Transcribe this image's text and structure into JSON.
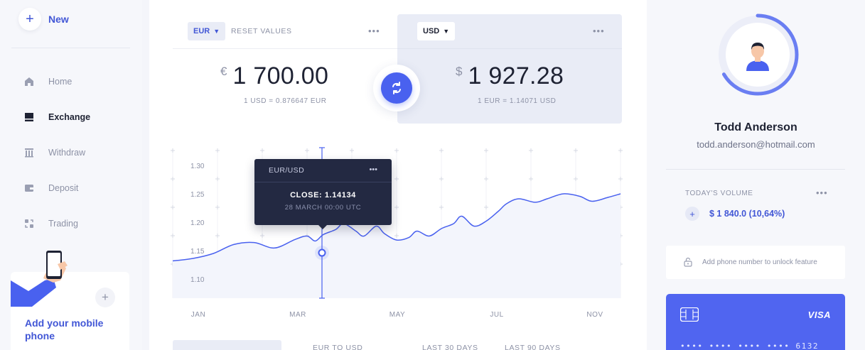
{
  "sidebar": {
    "new_label": "New",
    "items": [
      {
        "label": "Home",
        "icon": "home-icon"
      },
      {
        "label": "Exchange",
        "icon": "exchange-icon",
        "active": true
      },
      {
        "label": "Withdraw",
        "icon": "bank-icon"
      },
      {
        "label": "Deposit",
        "icon": "wallet-icon"
      },
      {
        "label": "Trading",
        "icon": "trading-icon"
      }
    ],
    "promo_text": "Add your mobile phone"
  },
  "converter": {
    "from": {
      "currency": "EUR",
      "reset_label": "RESET VALUES",
      "symbol": "€",
      "amount": "1 700.00",
      "rate": "1 USD = 0.876647 EUR"
    },
    "to": {
      "currency": "USD",
      "symbol": "$",
      "amount": "1 927.28",
      "rate": "1 EUR = 1.14071 USD"
    }
  },
  "chart_data": {
    "type": "line",
    "x": [
      "JAN",
      "MAR",
      "MAY",
      "JUL",
      "NOV"
    ],
    "yticks": [
      "1.30",
      "1.25",
      "1.20",
      "1.15",
      "1.10"
    ],
    "ylim": [
      1.05,
      1.35
    ],
    "points": [
      [
        0,
        1.125
      ],
      [
        0.5,
        1.13
      ],
      [
        1,
        1.14
      ],
      [
        1.5,
        1.158
      ],
      [
        2,
        1.162
      ],
      [
        2.5,
        1.151
      ],
      [
        3,
        1.168
      ],
      [
        3.3,
        1.175
      ],
      [
        3.5,
        1.165
      ],
      [
        3.7,
        1.178
      ],
      [
        4,
        1.188
      ],
      [
        4.2,
        1.2
      ],
      [
        4.5,
        1.185
      ],
      [
        4.7,
        1.175
      ],
      [
        5,
        1.195
      ],
      [
        5.2,
        1.18
      ],
      [
        5.5,
        1.167
      ],
      [
        5.8,
        1.172
      ],
      [
        6,
        1.185
      ],
      [
        6.3,
        1.175
      ],
      [
        6.6,
        1.19
      ],
      [
        6.9,
        1.2
      ],
      [
        7.1,
        1.215
      ],
      [
        7.4,
        1.195
      ],
      [
        7.7,
        1.205
      ],
      [
        8,
        1.225
      ],
      [
        8.2,
        1.24
      ],
      [
        8.5,
        1.25
      ],
      [
        8.9,
        1.243
      ],
      [
        9.2,
        1.25
      ],
      [
        9.6,
        1.26
      ],
      [
        10,
        1.255
      ],
      [
        10.3,
        1.245
      ],
      [
        10.7,
        1.253
      ],
      [
        11,
        1.26
      ]
    ],
    "tooltip": {
      "pair": "EUR/USD",
      "close": "CLOSE: 1.14134",
      "date": "28 MARCH 00:00 UTC"
    },
    "colors": {
      "line": "#4961ef",
      "area": "#f3f5fc"
    }
  },
  "tabs": [
    "EUR TO USD",
    "LAST 30 DAYS",
    "LAST 90 DAYS"
  ],
  "profile": {
    "name": "Todd Anderson",
    "email": "todd.anderson@hotmail.com",
    "volume_label": "TODAY'S VOLUME",
    "volume_value": "$ 1 840.0 (10,64%)",
    "lock_text": "Add phone number to unlock feature",
    "card_brand": "VISA",
    "card_number": "•••• •••• •••• •••• 6132"
  },
  "colors": {
    "accent": "#4961ef",
    "dark": "#232942"
  }
}
